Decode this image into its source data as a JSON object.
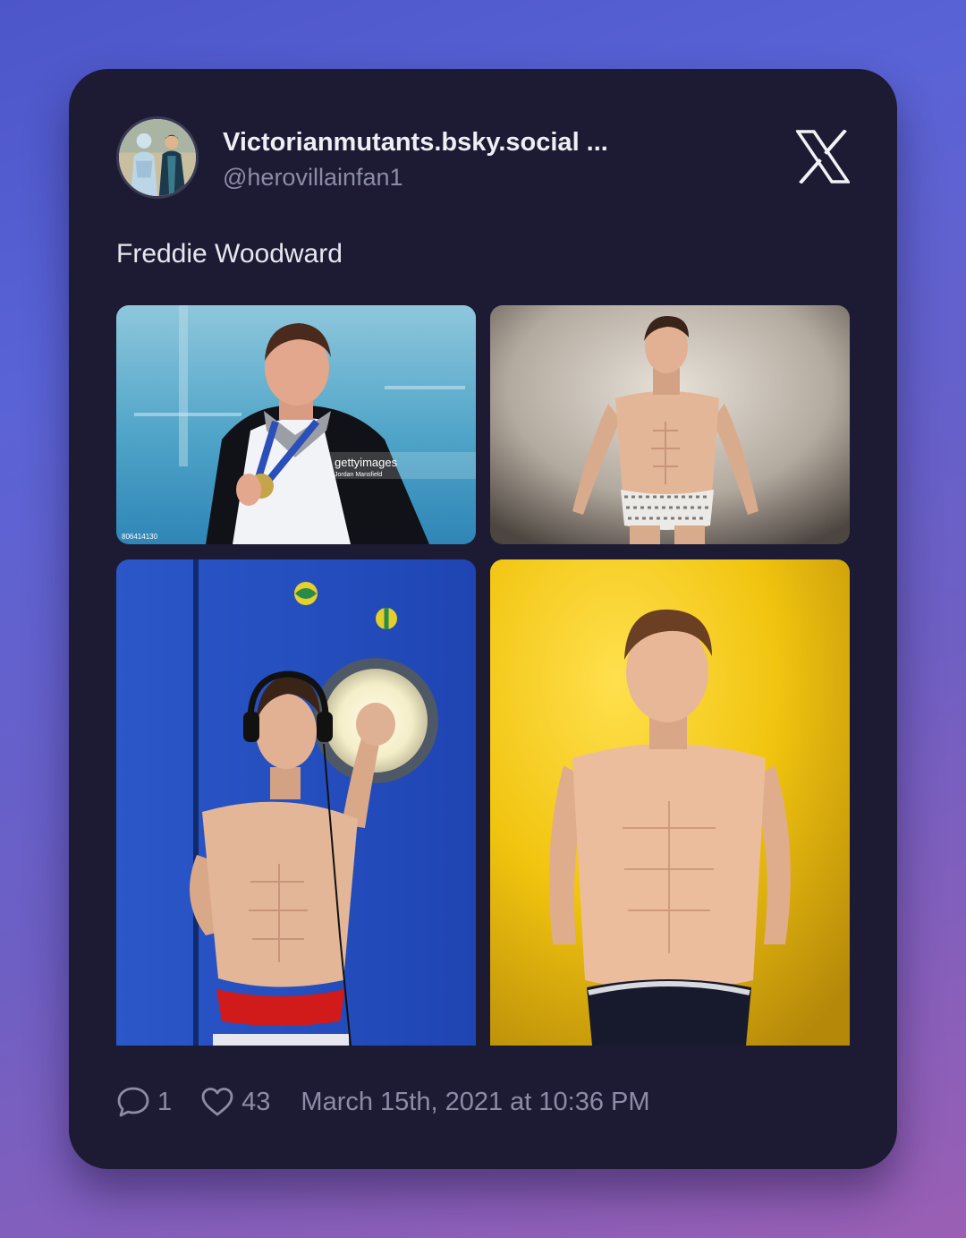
{
  "post": {
    "author": {
      "display_name": "Victorianmutants.bsky.social ...",
      "handle": "@herovillainfan1"
    },
    "text": "Freddie Woodward",
    "images": [
      {
        "icon": "photo-pool-medal"
      },
      {
        "icon": "photo-studio-portrait"
      },
      {
        "icon": "photo-blue-wall-juggling"
      },
      {
        "icon": "photo-yellow-wall"
      }
    ],
    "watermark": {
      "brand": "gettyimages",
      "credit": "Jordan Mansfield",
      "image_id": "806414130"
    },
    "stats": {
      "replies": "1",
      "likes": "43",
      "timestamp": "March 15th, 2021 at 10:36 PM"
    }
  },
  "icons": {
    "platform": "x-logo",
    "reply": "speech-bubble-icon",
    "like": "heart-icon"
  },
  "colors": {
    "card_background": "#1c1b33",
    "primary_text": "#eeeef4",
    "secondary_text": "#8c8ca6"
  }
}
